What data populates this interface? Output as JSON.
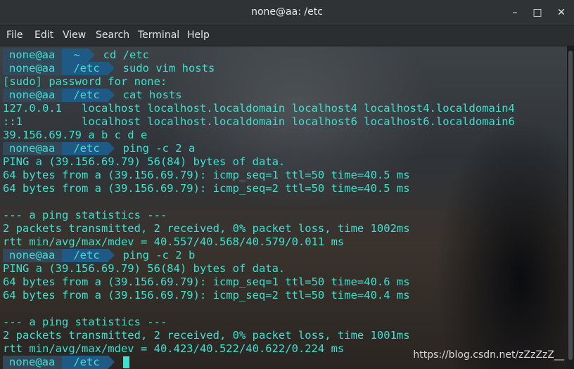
{
  "window": {
    "title": "none@aa: /etc",
    "minimize": "–",
    "maximize": "□",
    "close": "✕"
  },
  "menu": [
    "File",
    "Edit",
    "View",
    "Search",
    "Terminal",
    "Help"
  ],
  "lines": [
    {
      "type": "prompt",
      "user": "none@aa",
      "dir": "~",
      "cmd": "cd /etc"
    },
    {
      "type": "prompt",
      "user": "none@aa",
      "dir": "/etc",
      "cmd": "sudo vim hosts"
    },
    {
      "type": "out",
      "text": "[sudo] password for none:"
    },
    {
      "type": "prompt",
      "user": "none@aa",
      "dir": "/etc",
      "cmd": "cat hosts"
    },
    {
      "type": "out",
      "text": "127.0.0.1   localhost localhost.localdomain localhost4 localhost4.localdomain4"
    },
    {
      "type": "out",
      "text": "::1         localhost localhost.localdomain localhost6 localhost6.localdomain6"
    },
    {
      "type": "out",
      "text": "39.156.69.79 a b c d e"
    },
    {
      "type": "prompt",
      "user": "none@aa",
      "dir": "/etc",
      "cmd": "ping -c 2 a"
    },
    {
      "type": "out",
      "text": "PING a (39.156.69.79) 56(84) bytes of data."
    },
    {
      "type": "out",
      "text": "64 bytes from a (39.156.69.79): icmp_seq=1 ttl=50 time=40.5 ms"
    },
    {
      "type": "out",
      "text": "64 bytes from a (39.156.69.79): icmp_seq=2 ttl=50 time=40.5 ms"
    },
    {
      "type": "out",
      "text": ""
    },
    {
      "type": "out",
      "text": "--- a ping statistics ---"
    },
    {
      "type": "out",
      "text": "2 packets transmitted, 2 received, 0% packet loss, time 1002ms"
    },
    {
      "type": "out",
      "text": "rtt min/avg/max/mdev = 40.557/40.568/40.579/0.011 ms"
    },
    {
      "type": "prompt",
      "user": "none@aa",
      "dir": "/etc",
      "cmd": "ping -c 2 b"
    },
    {
      "type": "out",
      "text": "PING a (39.156.69.79) 56(84) bytes of data."
    },
    {
      "type": "out",
      "text": "64 bytes from a (39.156.69.79): icmp_seq=1 ttl=50 time=40.6 ms"
    },
    {
      "type": "out",
      "text": "64 bytes from a (39.156.69.79): icmp_seq=2 ttl=50 time=40.4 ms"
    },
    {
      "type": "out",
      "text": ""
    },
    {
      "type": "out",
      "text": "--- a ping statistics ---"
    },
    {
      "type": "out",
      "text": "2 packets transmitted, 2 received, 0% packet loss, time 1001ms"
    },
    {
      "type": "out",
      "text": "rtt min/avg/max/mdev = 40.423/40.522/40.622/0.224 ms"
    },
    {
      "type": "prompt",
      "user": "none@aa",
      "dir": "/etc",
      "cmd": "",
      "cursor": true
    }
  ],
  "watermark": "https://blog.csdn.net/zZzZzZ__",
  "colors": {
    "text": "#3fe0d0",
    "user_segment": "#32495b",
    "dir_segment": "#1f5a86"
  }
}
